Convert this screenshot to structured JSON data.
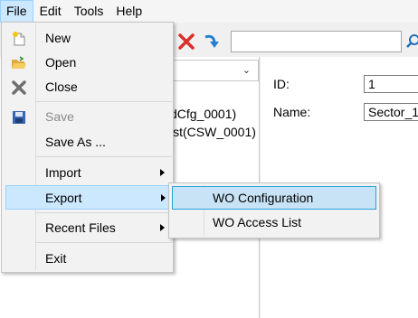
{
  "menubar": {
    "items": [
      "File",
      "Edit",
      "Tools",
      "Help"
    ]
  },
  "toolbar": {
    "search_value": ""
  },
  "tree": {
    "lines": [
      "dCfg_0001)",
      "ist(CSW_0001)"
    ]
  },
  "properties": {
    "id_label": "ID:",
    "id_value": "1",
    "name_label": "Name:",
    "name_value": "Sector_1"
  },
  "file_menu": {
    "new": "New",
    "open": "Open",
    "close": "Close",
    "save": "Save",
    "save_as": "Save As ...",
    "import": "Import",
    "export": "Export",
    "recent_files": "Recent Files",
    "exit": "Exit"
  },
  "export_submenu": {
    "items": [
      "WO Configuration",
      "WO Access List"
    ]
  },
  "colors": {
    "highlight": "#cce8ff",
    "highlight_border": "#99d1ff",
    "submenu_highlight_border": "#26a0da"
  }
}
